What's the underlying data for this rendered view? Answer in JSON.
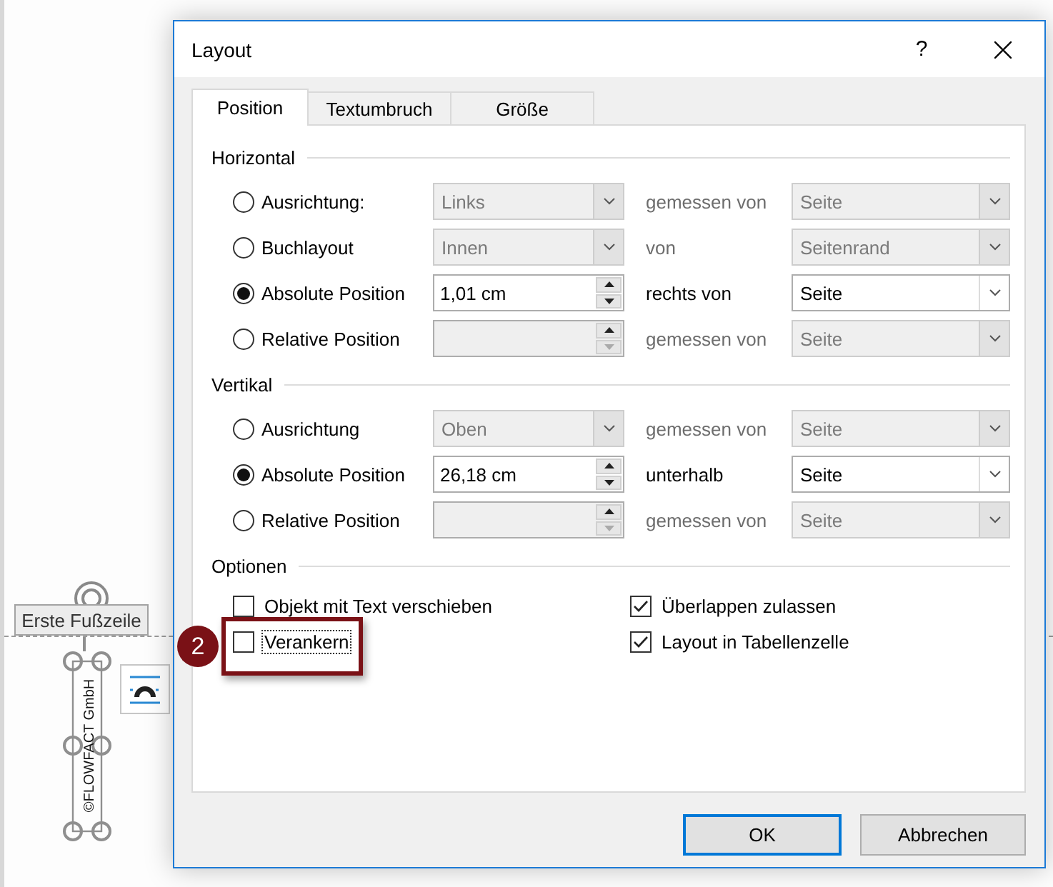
{
  "document": {
    "footer_tag": "Erste Fußzeile",
    "frame_text": "©FLOWFACT GmbH"
  },
  "callout": {
    "number": "2"
  },
  "dialog": {
    "title": "Layout",
    "help": "?",
    "tabs": [
      {
        "label": "Position",
        "selected": true
      },
      {
        "label": "Textumbruch",
        "selected": false
      },
      {
        "label": "Größe",
        "selected": false
      }
    ],
    "sections": [
      {
        "heading": "Horizontal",
        "rows": [
          {
            "label": "Ausrichtung:",
            "selected": false,
            "disabled": true,
            "control": {
              "kind": "dropdown",
              "value": "Links"
            },
            "relation": "gemessen von",
            "target": "Seite"
          },
          {
            "label": "Buchlayout",
            "selected": false,
            "disabled": true,
            "control": {
              "kind": "dropdown",
              "value": "Innen"
            },
            "relation": "von",
            "target": "Seitenrand"
          },
          {
            "label": "Absolute Position",
            "selected": true,
            "disabled": false,
            "control": {
              "kind": "spin",
              "value": "1,01 cm"
            },
            "relation": "rechts von",
            "target": "Seite"
          },
          {
            "label": "Relative Position",
            "selected": false,
            "disabled": true,
            "control": {
              "kind": "spin"
            },
            "relation": "gemessen von",
            "target": "Seite"
          }
        ]
      },
      {
        "heading": "Vertikal",
        "rows": [
          {
            "label": "Ausrichtung",
            "selected": false,
            "disabled": true,
            "control": {
              "kind": "dropdown",
              "value": "Oben"
            },
            "relation": "gemessen von",
            "target": "Seite"
          },
          {
            "label": "Absolute Position",
            "selected": true,
            "disabled": false,
            "control": {
              "kind": "spin",
              "value": "26,18 cm"
            },
            "relation": "unterhalb",
            "target": "Seite"
          },
          {
            "label": "Relative Position",
            "selected": false,
            "disabled": true,
            "control": {
              "kind": "spin"
            },
            "relation": "gemessen von",
            "target": "Seite"
          }
        ]
      }
    ],
    "options": {
      "heading": "Optionen",
      "items": [
        {
          "label": "Objekt mit Text verschieben",
          "checked": false,
          "focused": false
        },
        {
          "label": "Überlappen zulassen",
          "checked": true,
          "focused": false
        },
        {
          "label": "Verankern",
          "checked": false,
          "focused": true
        },
        {
          "label": "Layout in Tabellenzelle",
          "checked": true,
          "focused": false
        }
      ]
    },
    "buttons": [
      {
        "label": "OK",
        "default": true
      },
      {
        "label": "Abbrechen",
        "default": false
      }
    ]
  }
}
